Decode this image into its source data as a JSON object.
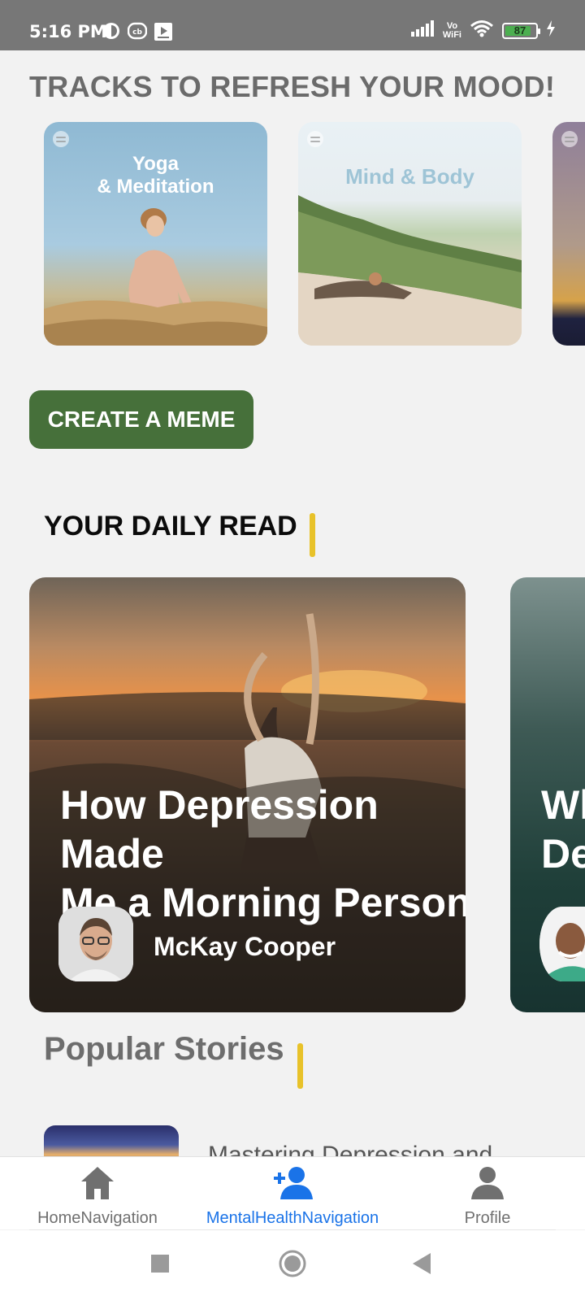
{
  "status_bar": {
    "time": "5:16 PM",
    "network": "Vo\nWiFi",
    "battery": "87"
  },
  "tracks": {
    "heading": "TRACKS TO REFRESH YOUR MOOD!",
    "items": [
      {
        "title": "Yoga\n& Meditation",
        "title_color": "#ffffff"
      },
      {
        "title": "Mind & Body",
        "title_color": "#9ec4d6"
      }
    ]
  },
  "meme_button": {
    "label": "CREATE A MEME"
  },
  "daily_read": {
    "heading": "YOUR DAILY READ",
    "items": [
      {
        "title": "How Depression Made\nMe a Morning Person",
        "author": "McKay Cooper"
      },
      {
        "title": "Wh\nDe"
      }
    ]
  },
  "popular": {
    "heading": "Popular Stories",
    "first_story_title": "Mastering Depression and"
  },
  "bottom_nav": {
    "items": [
      {
        "label": "HomeNavigation",
        "icon": "home-icon",
        "active": false
      },
      {
        "label": "MentalHealthNavigation",
        "icon": "add-person-icon",
        "active": true
      },
      {
        "label": "Profile",
        "icon": "profile-icon",
        "active": false
      }
    ],
    "active_color": "#1a73e8",
    "inactive_color": "#707070"
  },
  "colors": {
    "accent_yellow": "#e8c22a",
    "meme_button_green": "#46703a"
  }
}
